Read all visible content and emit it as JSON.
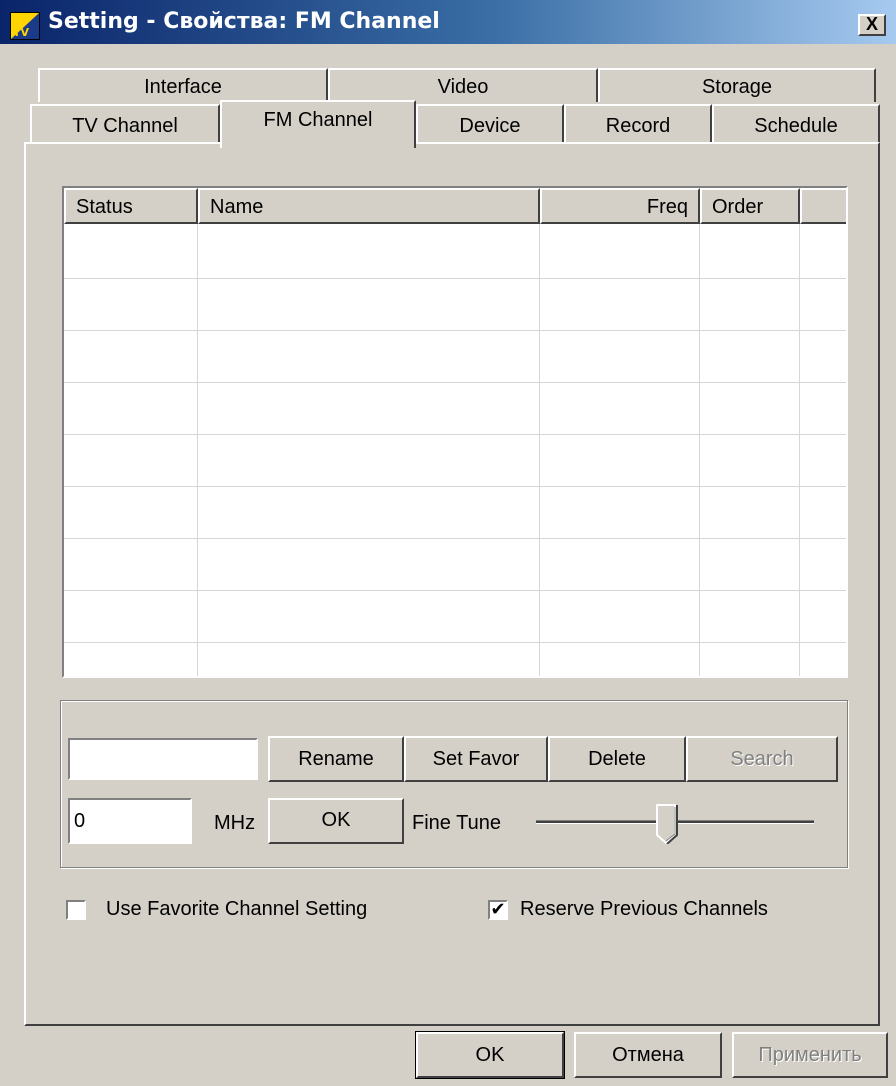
{
  "window": {
    "title": "Setting - Свойства: FM Channel",
    "close_glyph": "X"
  },
  "tabs": {
    "row1": [
      "Interface",
      "Video",
      "Storage"
    ],
    "row2": [
      "TV Channel",
      "FM Channel",
      "Device",
      "Record",
      "Schedule"
    ],
    "active": "FM Channel"
  },
  "channel_list": {
    "columns": [
      "Status",
      "Name",
      "Freq",
      "Order"
    ],
    "rows": []
  },
  "controls": {
    "name_input_value": "",
    "rename_label": "Rename",
    "set_favor_label": "Set Favor",
    "delete_label": "Delete",
    "search_label": "Search",
    "freq_input_value": "0",
    "freq_unit": "MHz",
    "ok_label": "OK",
    "fine_tune_label": "Fine Tune",
    "fine_tune_position": 0.5
  },
  "options": {
    "use_favorite_label": "Use Favorite Channel Setting",
    "use_favorite_checked": false,
    "reserve_previous_label": "Reserve Previous Channels",
    "reserve_previous_checked": true
  },
  "footer": {
    "ok_label": "OK",
    "cancel_label": "Отмена",
    "apply_label": "Применить"
  }
}
